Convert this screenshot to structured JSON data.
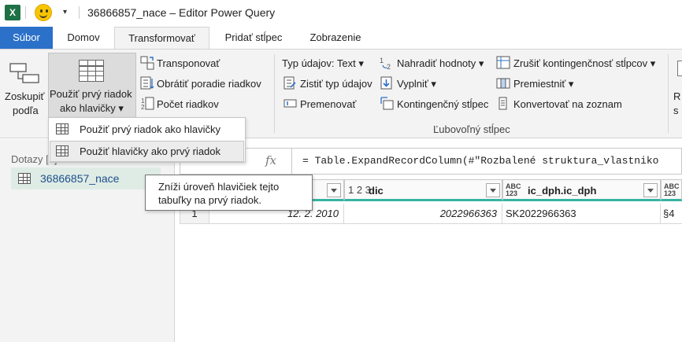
{
  "window": {
    "app_badge": "X",
    "qa_dropdown": "▾",
    "title": "36866857_nace – Editor Power Query"
  },
  "tabs": [
    {
      "label": "Súbor"
    },
    {
      "label": "Domov"
    },
    {
      "label": "Transformovať"
    },
    {
      "label": "Pridať stĺpec"
    },
    {
      "label": "Zobrazenie"
    }
  ],
  "ribbon": {
    "group_by": {
      "line1": "Zoskupiť",
      "line2": "podľa"
    },
    "use_first_row": {
      "line1": "Použiť prvý riadok",
      "line2": "ako hlavičky ▾"
    },
    "transpose": "Transponovať",
    "reverse_rows": "Obrátiť poradie riadkov",
    "count_rows": "Počet riadkov",
    "data_type": "Typ údajov: Text ▾",
    "detect_type": "Zistiť typ údajov",
    "rename": "Premenovať",
    "replace_values": "Nahradiť hodnoty ▾",
    "fill": "Vyplniť ▾",
    "pivot": "Kontingenčný stĺpec",
    "unpivot": "Zrušiť kontingenčnosť stĺpcov ▾",
    "move": "Premiestniť ▾",
    "convert_list": "Konvertovať na zoznam",
    "group_label_any_column": "Ľubovoľný stĺpec",
    "cut_text_1": "R",
    "cut_text_2": "s"
  },
  "menu": {
    "items": [
      {
        "label": "Použiť prvý riadok ako hlavičky"
      },
      {
        "label": "Použiť hlavičky ako prvý riadok"
      }
    ]
  },
  "tooltip": {
    "text": "Zníži úroveň hlavičiek tejto tabuľky na prvý riadok."
  },
  "queries": {
    "header": "Dotazy [1]",
    "items": [
      {
        "label": "36866857_nace"
      }
    ]
  },
  "formula": {
    "fx": "fx",
    "text": "= Table.ExpandRecordColumn(#\"Rozbalené struktura_vlastniko"
  },
  "grid": {
    "columns": [
      {
        "type": "1 2 3",
        "label": "dic"
      },
      {
        "type": "ABC 123",
        "label": "ic_dph.ic_dph"
      },
      {
        "type": "ABC 123",
        "label": ""
      }
    ],
    "rows": [
      {
        "num": "1",
        "date": "12. 2. 2010",
        "dic": "2022966363",
        "ic_dph": "SK2022966363",
        "extra": "§4"
      }
    ]
  },
  "colors": {
    "file_tab": "#2b70c9",
    "excel_green": "#1e7145",
    "selection": "#dfece6",
    "header_accent": "#36b3a1"
  }
}
